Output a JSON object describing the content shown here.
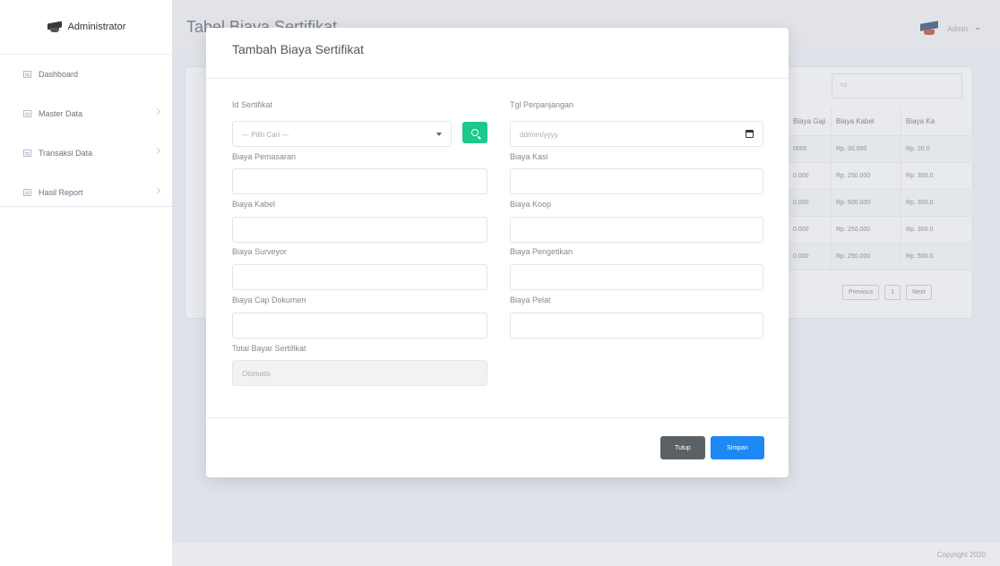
{
  "sidebar": {
    "brand": "Administrator",
    "items": [
      {
        "label": "Dashboard"
      },
      {
        "label": "Master Data"
      },
      {
        "label": "Transaksi Data"
      },
      {
        "label": "Hasil Report"
      }
    ]
  },
  "topbar": {
    "page_title": "Tabel Biaya Sertifikat",
    "user_name": "Admin"
  },
  "background_table": {
    "search_placeholder": "Ya",
    "columns": [
      "Biaya Gaji",
      "Biaya Kabel",
      "Biaya Ka"
    ],
    "rows": [
      [
        "0000",
        "Rp. 30.000",
        "Rp. 20.0"
      ],
      [
        "0.000",
        "Rp. 250.000",
        "Rp. 300.0"
      ],
      [
        "0.000",
        "Rp. 500.000",
        "Rp. 300.0"
      ],
      [
        "0.000",
        "Rp. 250.000",
        "Rp. 300.0"
      ],
      [
        "0.000",
        "Rp. 250.000",
        "Rp. 500.0"
      ]
    ],
    "pager": {
      "previous": "Previous",
      "page": "1",
      "next": "Next"
    }
  },
  "footer": {
    "copyright": "Copyright 2020"
  },
  "modal": {
    "title": "Tambah Biaya Sertifikat",
    "fields": {
      "id_sertifikat": {
        "label": "Id Sertifikat",
        "placeholder": "--- Pilih Cari ---"
      },
      "tgl_perpanjangan": {
        "label": "Tgl Perpanjangan",
        "placeholder": "dd/mm/yyyy"
      },
      "biaya_pemasaran": {
        "label": "Biaya Pemasaran"
      },
      "biaya_kasi": {
        "label": "Biaya Kasi"
      },
      "biaya_kabel": {
        "label": "Biaya Kabel"
      },
      "biaya_koop": {
        "label": "Biaya Koop"
      },
      "biaya_surveyor": {
        "label": "Biaya Surveyor"
      },
      "biaya_pengetikan": {
        "label": "Biaya Pengetikan"
      },
      "biaya_cap_dokumen": {
        "label": "Biaya Cap Dokumen"
      },
      "biaya_pelat": {
        "label": "Biaya Pelat"
      },
      "total_bayar": {
        "label": "Total Bayar Sertifikat",
        "placeholder": "Otomatis"
      }
    },
    "buttons": {
      "close": "Tutup",
      "save": "Simpan"
    }
  },
  "colors": {
    "accent_green": "#1cc88a",
    "accent_blue": "#1e88f5",
    "close_gray": "#5a6268"
  }
}
